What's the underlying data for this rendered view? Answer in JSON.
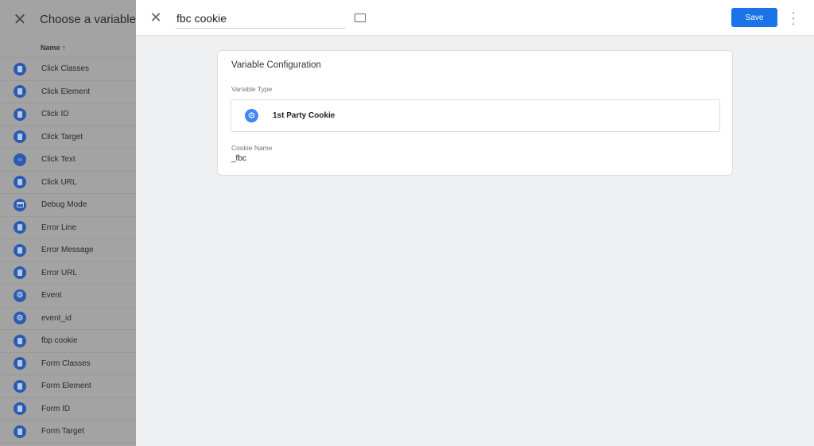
{
  "chooser": {
    "title": "Choose a variable",
    "column_header": "Name ↑",
    "items": [
      {
        "label": "Click Classes",
        "icon": "document-icon"
      },
      {
        "label": "Click Element",
        "icon": "document-icon"
      },
      {
        "label": "Click ID",
        "icon": "document-icon"
      },
      {
        "label": "Click Target",
        "icon": "document-icon"
      },
      {
        "label": "Click Text",
        "icon": "code-icon"
      },
      {
        "label": "Click URL",
        "icon": "document-icon"
      },
      {
        "label": "Debug Mode",
        "icon": "window-icon"
      },
      {
        "label": "Error Line",
        "icon": "document-icon"
      },
      {
        "label": "Error Message",
        "icon": "document-icon"
      },
      {
        "label": "Error URL",
        "icon": "document-icon"
      },
      {
        "label": "Event",
        "icon": "gear-icon"
      },
      {
        "label": "event_id",
        "icon": "gear-icon"
      },
      {
        "label": "fbp cookie",
        "icon": "document-icon"
      },
      {
        "label": "Form Classes",
        "icon": "document-icon"
      },
      {
        "label": "Form Element",
        "icon": "document-icon"
      },
      {
        "label": "Form ID",
        "icon": "document-icon"
      },
      {
        "label": "Form Target",
        "icon": "document-icon"
      }
    ]
  },
  "editor": {
    "name": "fbc cookie",
    "save_label": "Save",
    "card_title": "Variable Configuration",
    "variable_type_label": "Variable Type",
    "variable_type": "1st Party Cookie",
    "cookie_name_label": "Cookie Name",
    "cookie_name": "_fbc"
  },
  "colors": {
    "accent": "#1a73e8",
    "icon_blue": "#4285f4"
  }
}
